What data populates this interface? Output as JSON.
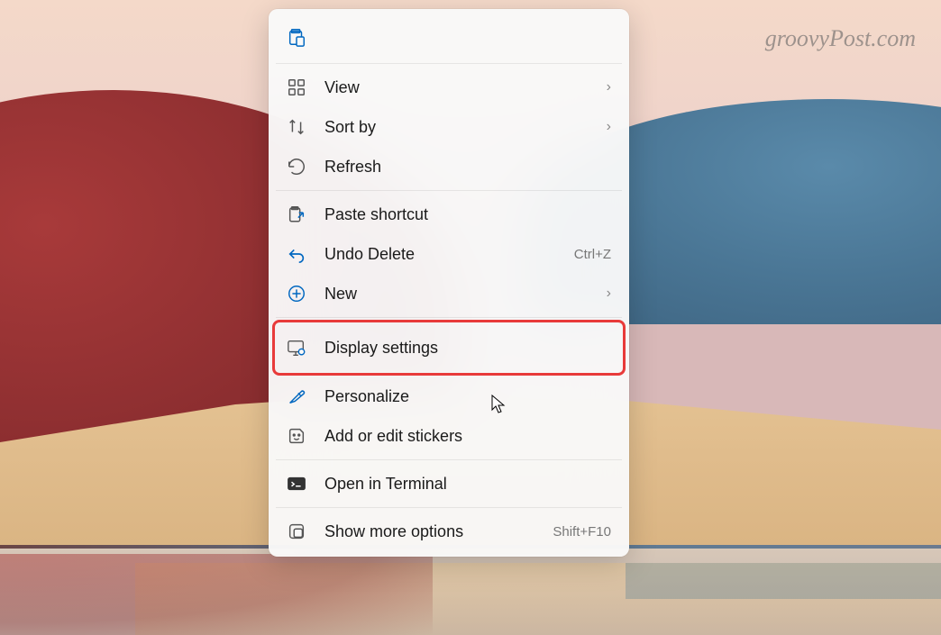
{
  "watermark": "groovyPost.com",
  "menu": {
    "items": [
      {
        "label": "View",
        "has_submenu": true
      },
      {
        "label": "Sort by",
        "has_submenu": true
      },
      {
        "label": "Refresh",
        "has_submenu": false
      },
      {
        "label": "Paste shortcut",
        "has_submenu": false
      },
      {
        "label": "Undo Delete",
        "has_submenu": false,
        "shortcut": "Ctrl+Z"
      },
      {
        "label": "New",
        "has_submenu": true
      },
      {
        "label": "Display settings",
        "has_submenu": false,
        "highlighted": true
      },
      {
        "label": "Personalize",
        "has_submenu": false
      },
      {
        "label": "Add or edit stickers",
        "has_submenu": false
      },
      {
        "label": "Open in Terminal",
        "has_submenu": false
      },
      {
        "label": "Show more options",
        "has_submenu": false,
        "shortcut": "Shift+F10"
      }
    ]
  }
}
